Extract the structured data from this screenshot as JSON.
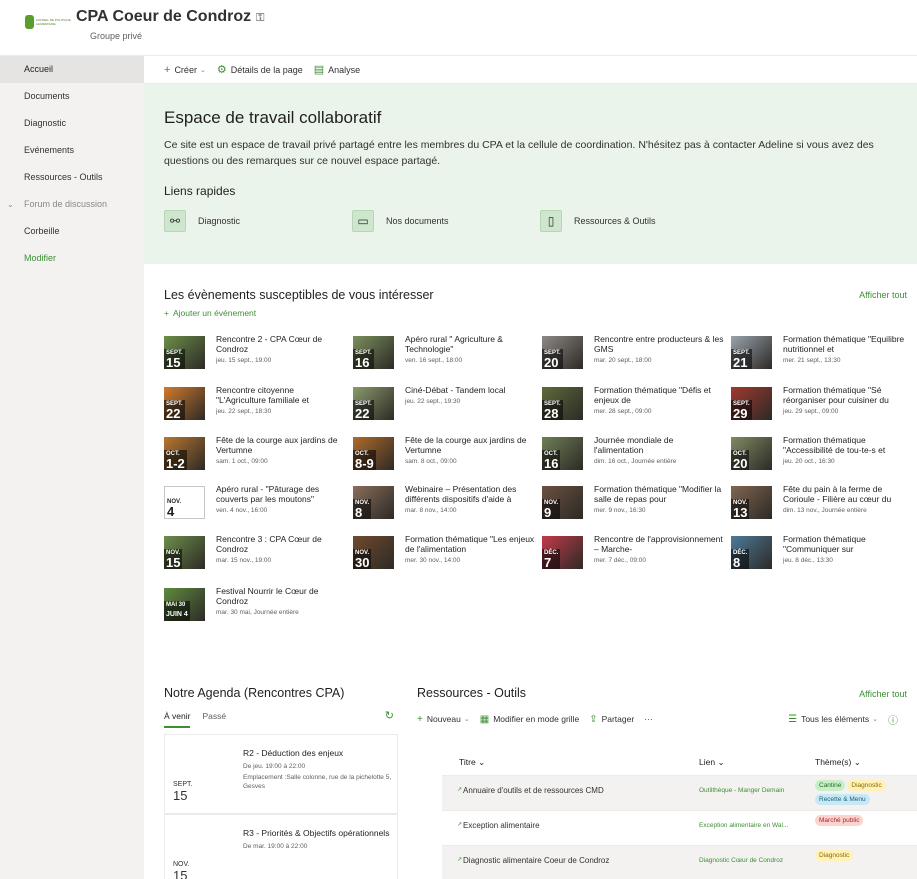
{
  "site": {
    "title": "CPA Coeur de Condroz",
    "subtitle": "Groupe privé",
    "logo_text": "CONSEIL DE POLITIQUE ALIMENTAIRE"
  },
  "sidebar": {
    "items": [
      {
        "label": "Accueil",
        "state": "active"
      },
      {
        "label": "Documents"
      },
      {
        "label": "Diagnostic"
      },
      {
        "label": "Evénements"
      },
      {
        "label": "Ressources - Outils"
      },
      {
        "label": "Forum de discussion",
        "state": "muted",
        "expand": "⌄"
      },
      {
        "label": "Corbeille"
      },
      {
        "label": "Modifier",
        "state": "edit"
      }
    ]
  },
  "commandbar": {
    "create": "Créer",
    "details": "Détails de la page",
    "analytics": "Analyse"
  },
  "hero": {
    "title": "Espace de travail collaboratif",
    "description": "Ce site est un espace de travail privé partagé entre les membres du CPA et la cellule de coordination. N'hésitez pas à contacter Adeline si vous avez des questions ou des remarques sur ce nouvel espace partagé.",
    "quick_links_title": "Liens rapides",
    "quick_links": [
      {
        "label": "Diagnostic",
        "icon": "flow-icon"
      },
      {
        "label": "Nos documents",
        "icon": "folder-search-icon"
      },
      {
        "label": "Ressources & Outils",
        "icon": "book-icon"
      }
    ]
  },
  "events": {
    "title": "Les évènements susceptibles de vous intéresser",
    "show_all": "Afficher tout",
    "add_label": "Ajouter un événement",
    "items": [
      {
        "name": "Rencontre 2 - CPA Cœur de Condroz",
        "date": "jeu. 15 sept., 19:00",
        "month": "SEPT.",
        "day": "15",
        "color": "#6c8e4a"
      },
      {
        "name": "Apéro rural \" Agriculture & Technologie\"",
        "date": "ven. 16 sept., 18:00",
        "month": "SEPT.",
        "day": "16",
        "color": "#7a8f5c"
      },
      {
        "name": "Rencontre entre producteurs & les GMS",
        "date": "mar. 20 sept., 18:00",
        "month": "SEPT.",
        "day": "20",
        "color": "#8d8a86"
      },
      {
        "name": "Formation thématique \"Equilibre nutritionnel et",
        "date": "mer. 21 sept., 13:30",
        "month": "SEPT.",
        "day": "21",
        "color": "#9aa3ad"
      },
      {
        "name": "Rencontre citoyenne \"L'Agriculture familiale et",
        "date": "jeu. 22 sept., 18:30",
        "month": "SEPT.",
        "day": "22",
        "color": "#d27a2c"
      },
      {
        "name": "Ciné-Débat - Tandem local",
        "date": "jeu. 22 sept., 19:30",
        "month": "SEPT.",
        "day": "22",
        "color": "#8a9a6b"
      },
      {
        "name": "Formation thématique \"Défis et enjeux de",
        "date": "mer. 28 sept., 09:00",
        "month": "SEPT.",
        "day": "28",
        "color": "#5d6b3a"
      },
      {
        "name": "Formation thématique \"Sé réorganiser pour cuisiner du",
        "date": "jeu. 29 sept., 09:00",
        "month": "SEPT.",
        "day": "29",
        "color": "#a0392f"
      },
      {
        "name": "Fête de la courge aux jardins de Vertumne",
        "date": "sam. 1 oct., 09:00",
        "month": "OCT.",
        "day": "1-2",
        "color": "#b8762f"
      },
      {
        "name": "Fête de la courge aux jardins de Vertumne",
        "date": "sam. 8 oct., 09:00",
        "month": "OCT.",
        "day": "8-9",
        "color": "#b06a2a"
      },
      {
        "name": "Journée mondiale de l'alimentation",
        "date": "dim. 16 oct., Journée entière",
        "month": "OCT.",
        "day": "16",
        "color": "#6d7f55"
      },
      {
        "name": "Formation thématique \"Accessibilité de tou-te-s et",
        "date": "jeu. 20 oct., 16:30",
        "month": "OCT.",
        "day": "20",
        "color": "#7f8a63"
      },
      {
        "name": "Apéro rural - \"Pâturage des couverts par les moutons\"",
        "date": "ven. 4 nov., 16:00",
        "month": "NOV.",
        "day": "4",
        "color": "plain"
      },
      {
        "name": "Webinaire – Présentation des différents dispositifs d'aide à",
        "date": "mar. 8 nov., 14:00",
        "month": "NOV.",
        "day": "8",
        "color": "#8a6e5a"
      },
      {
        "name": "Formation thématique \"Modifier la salle de repas pour",
        "date": "mer. 9 nov., 16:30",
        "month": "NOV.",
        "day": "9",
        "color": "#6a5040"
      },
      {
        "name": "Fête du pain à la ferme de Corioule - Filière au cœur du",
        "date": "dim. 13 nov., Journée entière",
        "month": "NOV.",
        "day": "13",
        "color": "#806650"
      },
      {
        "name": "Rencontre 3 : CPA Cœur de Condroz",
        "date": "mar. 15 nov., 19:00",
        "month": "NOV.",
        "day": "15",
        "color": "#6c8e4a"
      },
      {
        "name": "Formation thématique \"Les enjeux de l'alimentation",
        "date": "mer. 30 nov., 14:00",
        "month": "NOV.",
        "day": "30",
        "color": "#704a2e"
      },
      {
        "name": "Rencontre de l'approvisionnement – Marche-",
        "date": "mer. 7 déc., 09:00",
        "month": "DÉC.",
        "day": "7",
        "color": "#c23a4a"
      },
      {
        "name": "Formation thématique \"Communiquer sur",
        "date": "jeu. 8 déc., 13:30",
        "month": "DÉC.",
        "day": "8",
        "color": "#4d7a9a"
      },
      {
        "name": "Festival Nourrir le Cœur de Condroz",
        "date": "mar. 30 mai, Journée entière",
        "month": "MAI 30",
        "day": "JUIN 4",
        "color": "#5f8a3e"
      }
    ]
  },
  "agenda": {
    "title": "Notre Agenda (Rencontres CPA)",
    "tabs": [
      "À venir",
      "Passé"
    ],
    "items": [
      {
        "month": "SEPT.",
        "day": "15",
        "name": "R2 - Déduction des enjeux",
        "time": "De jeu. 19:00 à 22:00",
        "location": "Emplacement :Salle colonne, rue de la pichelotte 5, Gesves"
      },
      {
        "month": "NOV.",
        "day": "15",
        "name": "R3 - Priorités & Objectifs opérationnels",
        "time": "De mar. 19:00 à 22:00",
        "location": ""
      }
    ]
  },
  "resources": {
    "title": "Ressources - Outils",
    "show_all": "Afficher tout",
    "toolbar": {
      "new": "Nouveau",
      "grid": "Modifier en mode grille",
      "share": "Partager",
      "more": "···",
      "view": "Tous les éléments",
      "info": "ⓘ"
    },
    "columns": [
      "Titre",
      "Lien",
      "Thème(s)"
    ],
    "rows": [
      {
        "title": "Annuaire d'outils et de ressources CMD",
        "link": "Outilthèque - Manger Demain",
        "tags": [
          {
            "t": "Cantine",
            "c": "g"
          },
          {
            "t": "Diagnostic",
            "c": "y"
          },
          {
            "t": "Recette & Menu",
            "c": "b"
          }
        ]
      },
      {
        "title": "Exception alimentaire",
        "link": "Exception alimentaire en Wal...",
        "tags": [
          {
            "t": "Marché public",
            "c": "r"
          }
        ]
      },
      {
        "title": "Diagnostic alimentaire Coeur de Condroz",
        "link": "Diagnostic Cœur de Condroz",
        "tags": [
          {
            "t": "Diagnostic",
            "c": "y"
          }
        ]
      }
    ]
  },
  "colors": {
    "accent": "#3d8f34",
    "hero_bg": "#eaf4ea",
    "sidebar_bg": "#f3f2f1"
  }
}
